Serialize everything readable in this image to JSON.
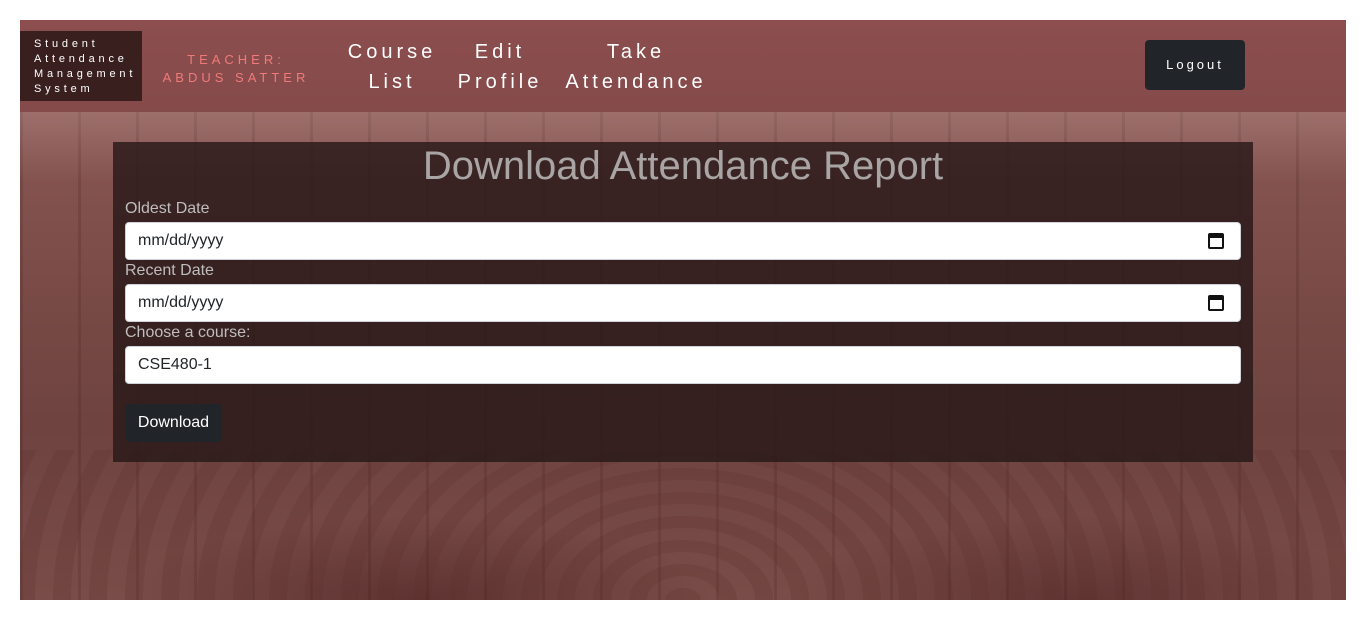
{
  "navbar": {
    "brand_lines": [
      "Student",
      "Attendance",
      "Management",
      "System"
    ],
    "teacher_lines": [
      "TEACHER:",
      "ABDUS SATTER"
    ],
    "links": [
      {
        "lines": [
          "Course",
          "List"
        ]
      },
      {
        "lines": [
          "Edit",
          "Profile"
        ]
      },
      {
        "lines": [
          "Take",
          "Attendance"
        ]
      }
    ],
    "logout_label": "Logout"
  },
  "form": {
    "title": "Download Attendance Report",
    "oldest_label": "Oldest Date",
    "oldest_value": "mm/dd/yyyy",
    "recent_label": "Recent Date",
    "recent_value": "mm/dd/yyyy",
    "course_label": "Choose a course:",
    "course_value": "CSE480-1",
    "download_label": "Download"
  },
  "icons": {
    "date_picker": "calendar-icon"
  },
  "colors": {
    "navbar_bg": "#8c4e4e",
    "brand_bg": "#3a1f1f",
    "teacher_text": "#f07a7a",
    "button_bg": "#212529",
    "card_bg": "rgba(40,24,24,0.82)",
    "title_text": "#a9a5a5"
  }
}
